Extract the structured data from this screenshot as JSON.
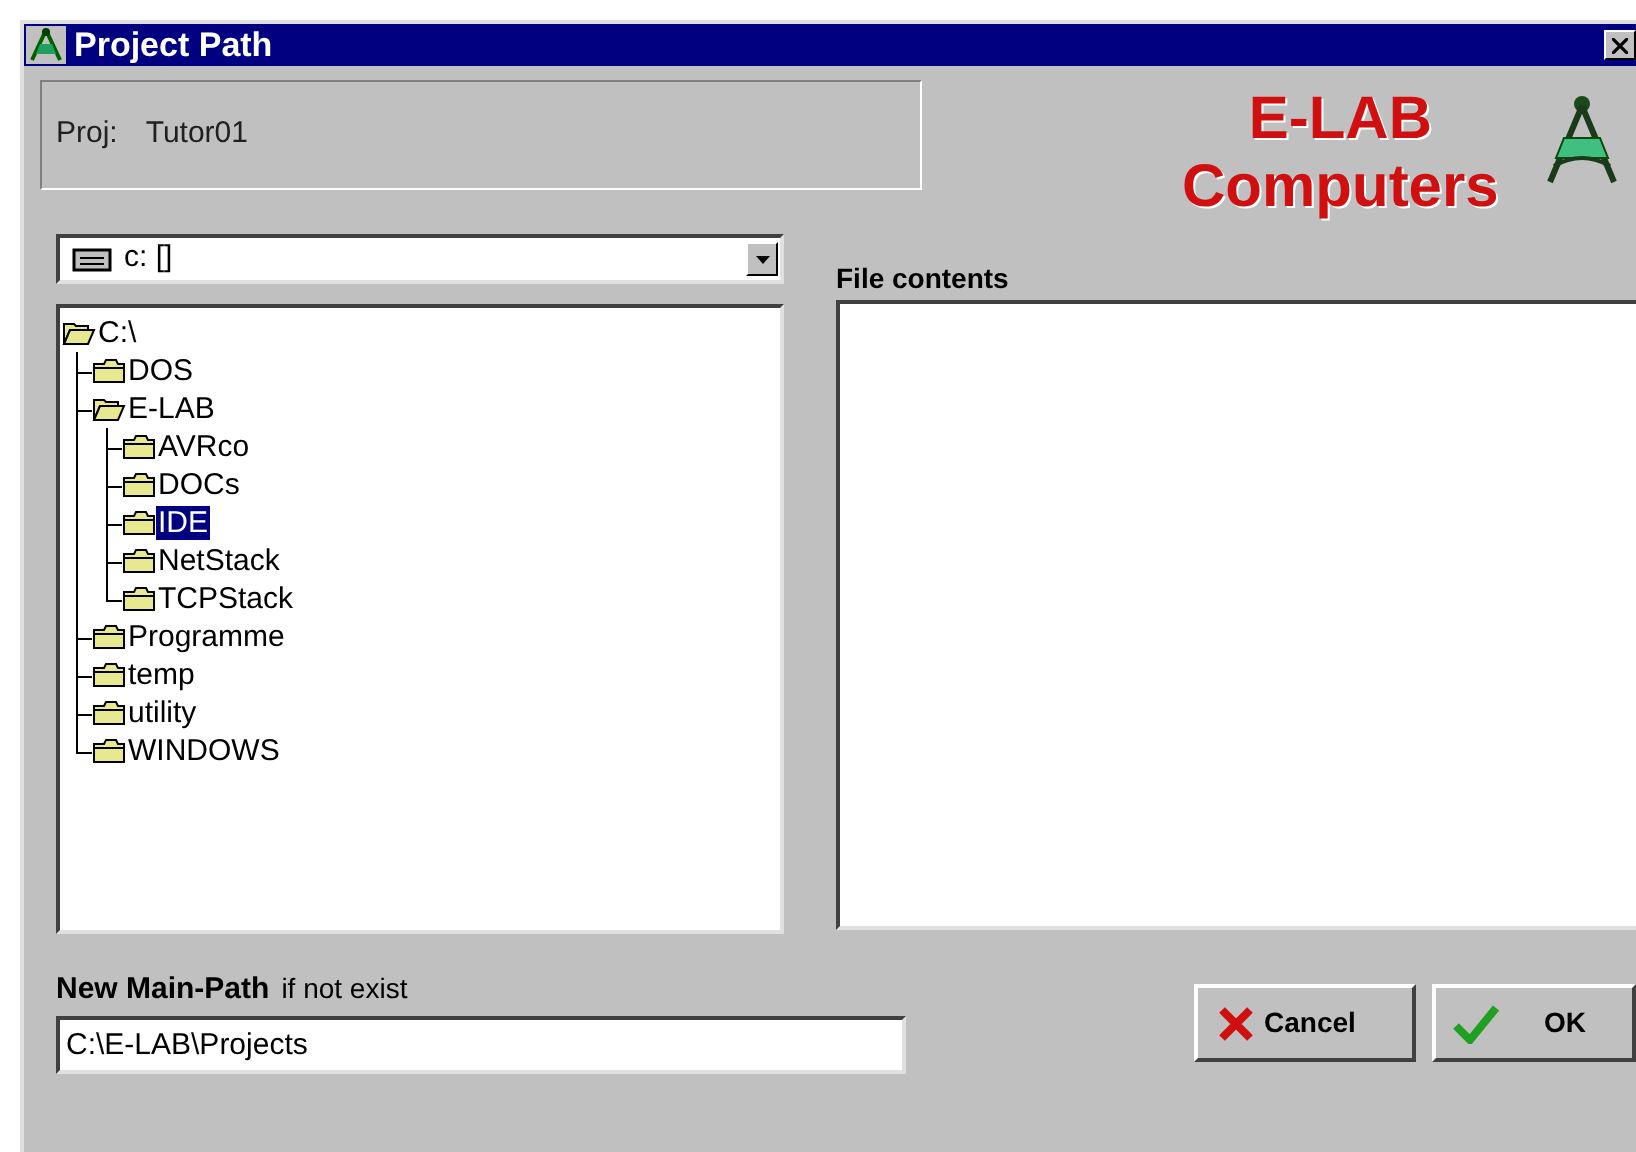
{
  "window": {
    "title": "Project Path"
  },
  "project": {
    "label": "Proj:",
    "value": "Tutor01"
  },
  "logo": {
    "line_1": "E-LAB",
    "line_2": "Computers"
  },
  "drive": {
    "value": "c: []"
  },
  "tree": [
    {
      "label": "C:\\",
      "expanded": true,
      "selected": false,
      "children": [
        {
          "label": "DOS",
          "expanded": false,
          "selected": false
        },
        {
          "label": "E-LAB",
          "expanded": true,
          "selected": false,
          "children": [
            {
              "label": "AVRco",
              "expanded": false,
              "selected": false
            },
            {
              "label": "DOCs",
              "expanded": false,
              "selected": false
            },
            {
              "label": "IDE",
              "expanded": false,
              "selected": true
            },
            {
              "label": "NetStack",
              "expanded": false,
              "selected": false
            },
            {
              "label": "TCPStack",
              "expanded": false,
              "selected": false
            }
          ]
        },
        {
          "label": "Programme",
          "expanded": false,
          "selected": false
        },
        {
          "label": "temp",
          "expanded": false,
          "selected": false
        },
        {
          "label": "utility",
          "expanded": false,
          "selected": false
        },
        {
          "label": "WINDOWS",
          "expanded": false,
          "selected": false
        }
      ]
    }
  ],
  "file_contents": {
    "label": "File contents"
  },
  "new_path": {
    "label": "New Main-Path",
    "hint": "if not exist",
    "value": "C:\\E-LAB\\Projects"
  },
  "buttons": [
    {
      "kind": "cancel",
      "label": "Cancel"
    },
    {
      "kind": "ok",
      "label": "OK"
    }
  ]
}
